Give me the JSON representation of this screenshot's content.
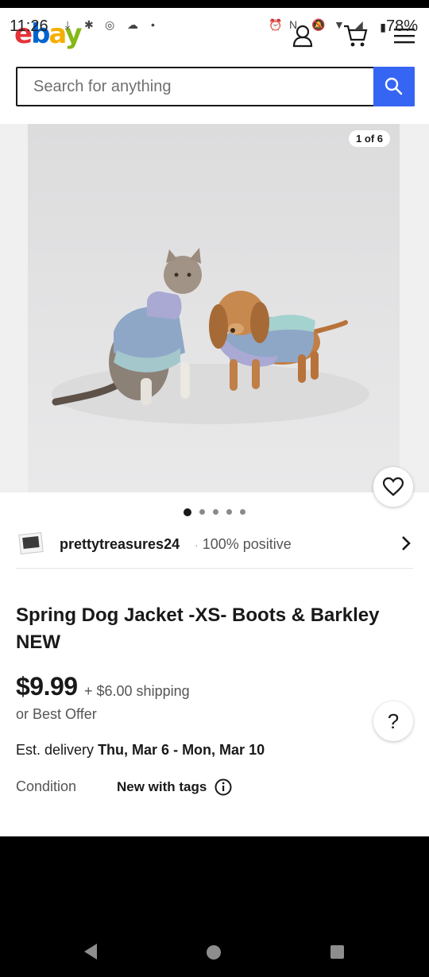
{
  "status_bar": {
    "time": "11:26",
    "battery": "78%"
  },
  "header": {
    "logo_letters": [
      "e",
      "b",
      "a",
      "y"
    ]
  },
  "search": {
    "placeholder": "Search for anything"
  },
  "gallery": {
    "counter": "1 of 6",
    "dot_count": 5,
    "active_dot": 0
  },
  "seller": {
    "name": "prettytreasures24",
    "separator": "·",
    "rating": "100% positive"
  },
  "listing": {
    "title": "Spring Dog Jacket -XS- Boots & Barkley NEW",
    "price": "$9.99",
    "shipping": "+ $6.00 shipping",
    "offer": "or Best Offer",
    "delivery_label": "Est. delivery",
    "delivery_dates": "Thu, Mar 6 - Mon, Mar 10",
    "condition_label": "Condition",
    "condition_value": "New with tags"
  },
  "help": {
    "label": "?"
  },
  "colors": {
    "search_button": "#3665f3",
    "logo_e": "#e53238",
    "logo_b": "#0064d2",
    "logo_a": "#f5af02",
    "logo_y": "#86b817"
  }
}
